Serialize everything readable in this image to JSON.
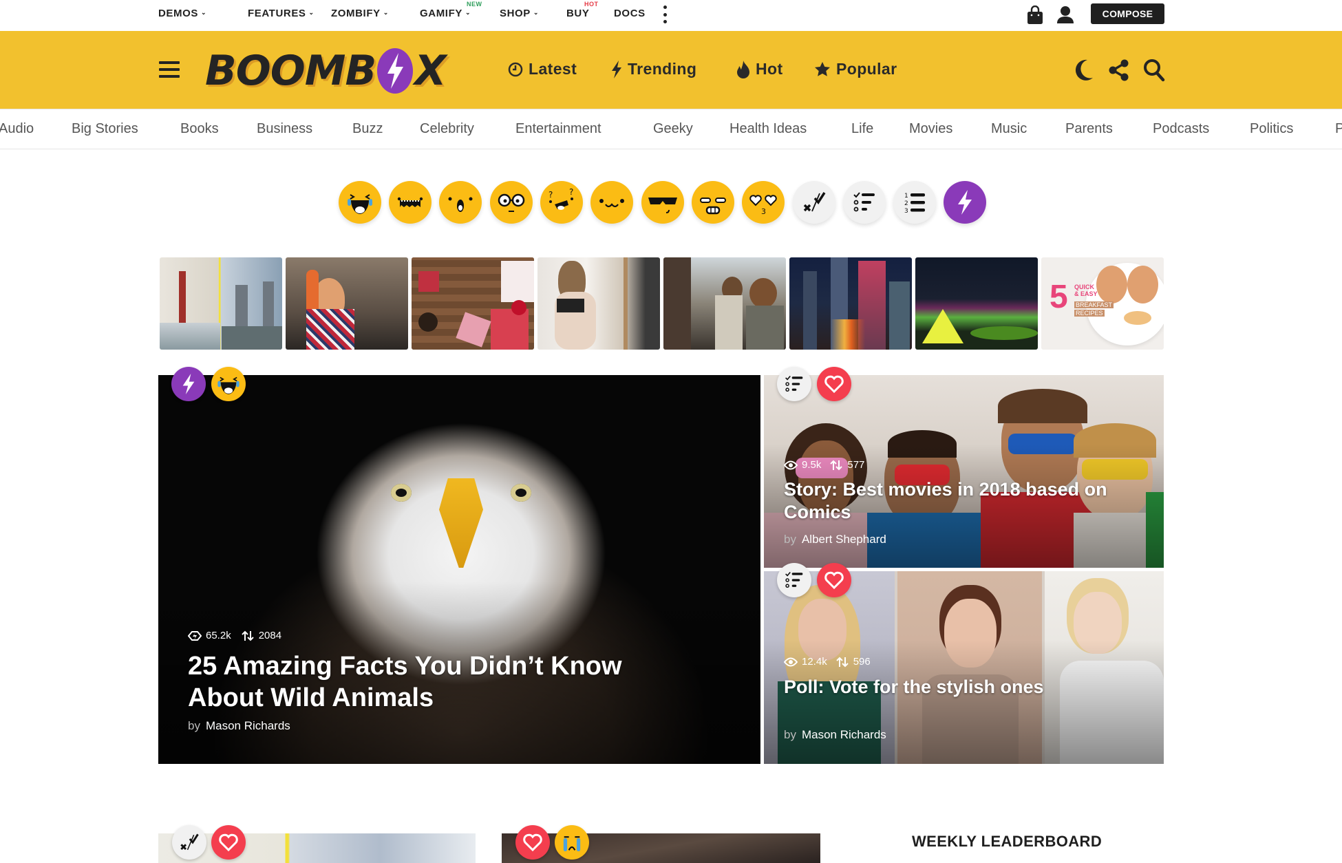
{
  "topbar": {
    "items": [
      {
        "label": "DEMOS",
        "dropdown": true
      },
      {
        "label": "FEATURES",
        "dropdown": true
      },
      {
        "label": "ZOMBIFY",
        "dropdown": true
      },
      {
        "label": "GAMIFY",
        "dropdown": true,
        "badge": "NEW",
        "badge_color": "#2e9e5b"
      },
      {
        "label": "SHOP",
        "dropdown": true
      },
      {
        "label": "BUY",
        "dropdown": false,
        "badge": "HOT",
        "badge_color": "#e53945"
      },
      {
        "label": "DOCS",
        "dropdown": false
      }
    ],
    "more_icon": "vertical-dots-icon",
    "cart_icon": "shopping-bag-icon",
    "user_icon": "user-icon",
    "compose_label": "COMPOSE"
  },
  "header": {
    "brand_color": "#f2c12e",
    "logo_text_left": "BOOMB",
    "logo_text_right": "X",
    "nav": [
      {
        "label": "Latest",
        "icon": "clock-icon"
      },
      {
        "label": "Trending",
        "icon": "lightning-icon"
      },
      {
        "label": "Hot",
        "icon": "flame-icon"
      },
      {
        "label": "Popular",
        "icon": "star-icon"
      }
    ],
    "actions": [
      "moon-icon",
      "share-icon",
      "search-icon"
    ]
  },
  "categories": [
    "Audio",
    "Big Stories",
    "Books",
    "Business",
    "Buzz",
    "Celebrity",
    "Entertainment",
    "Geeky",
    "Health Ideas",
    "Life",
    "Movies",
    "Music",
    "Parents",
    "Podcasts",
    "Politics",
    "P"
  ],
  "reactions": [
    {
      "name": "lol",
      "style": "yellow"
    },
    {
      "name": "omg",
      "style": "yellow"
    },
    {
      "name": "wow",
      "style": "yellow"
    },
    {
      "name": "geeky",
      "style": "yellow"
    },
    {
      "name": "confused",
      "style": "yellow"
    },
    {
      "name": "cute",
      "style": "yellow"
    },
    {
      "name": "cool",
      "style": "yellow"
    },
    {
      "name": "angry",
      "style": "yellow"
    },
    {
      "name": "love",
      "style": "yellow"
    },
    {
      "name": "trivia-quiz",
      "style": "grey"
    },
    {
      "name": "poll",
      "style": "grey"
    },
    {
      "name": "list",
      "style": "grey"
    },
    {
      "name": "trending",
      "style": "purple"
    }
  ],
  "thumbnails": [
    "Golden Gate and Tower Bridge",
    "DJ girl with headphones",
    "Gift wrapping on table",
    "Woman sitting by window",
    "Friends at concert",
    "City skyline at night",
    "Tent under aurora",
    "5 Quick & Easy Breakfast Recipes"
  ],
  "thumbnail_text": {
    "number": "5",
    "line1": "QUICK",
    "line2": "& EASY",
    "line3": "BREAKFAST",
    "line4": "RECIPES"
  },
  "hero": {
    "badges": [
      "trending",
      "lol"
    ],
    "views": "65.2k",
    "shares": "2084",
    "title": "25 Amazing Facts You Didn’t Know About Wild Animals",
    "by": "by",
    "author": "Mason Richards"
  },
  "side_cards": [
    {
      "badges": [
        "poll",
        "love"
      ],
      "views": "9.5k",
      "shares": "577",
      "title": "Story: Best movies in 2018 based on Comics",
      "by": "by",
      "author": "Albert Shephard"
    },
    {
      "badges": [
        "poll",
        "love"
      ],
      "views": "12.4k",
      "shares": "596",
      "title": "Poll: Vote for the stylish ones",
      "by": "by",
      "author": "Mason Richards"
    }
  ],
  "bottom": {
    "card1_badges": [
      "trivia-quiz",
      "love"
    ],
    "card2_badges": [
      "love",
      "cry"
    ],
    "leaderboard_title": "WEEKLY LEADERBOARD"
  }
}
